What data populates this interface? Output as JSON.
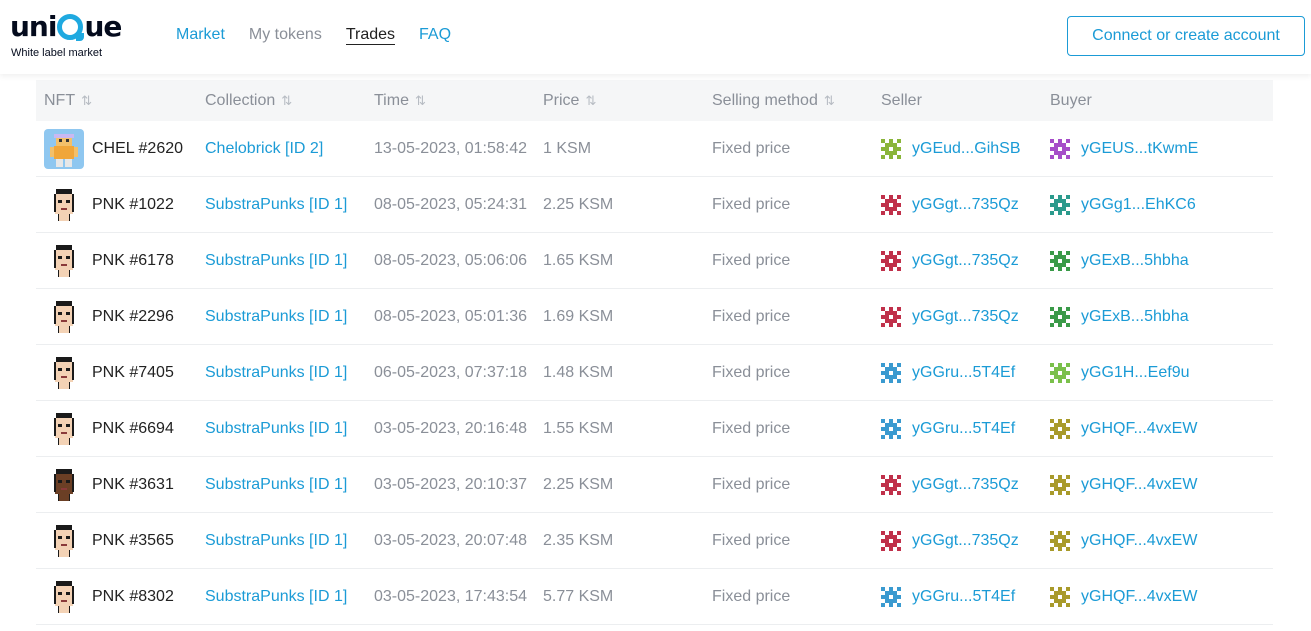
{
  "brand": {
    "logo_text_left": "uni",
    "logo_text_right": "ue",
    "tagline": "White label market"
  },
  "nav": {
    "market": "Market",
    "my_tokens": "My tokens",
    "trades": "Trades",
    "faq": "FAQ"
  },
  "connect_label": "Connect or create account",
  "columns": {
    "nft": "NFT",
    "collection": "Collection",
    "time": "Time",
    "price": "Price",
    "method": "Selling method",
    "seller": "Seller",
    "buyer": "Buyer"
  },
  "sort_icon": "⇅",
  "colors": {
    "accent": "#1b9bd6",
    "muted": "#8a8f98"
  },
  "rows": [
    {
      "nft": "CHEL #2620",
      "collection": "Chelobrick [ID 2]",
      "time": "13-05-2023, 01:58:42",
      "price": "1 KSM",
      "method": "Fixed price",
      "seller": "yGEud...GihSB",
      "buyer": "yGEUS...tKwmE",
      "seller_color": "#8ab53a",
      "buyer_color": "#a64dc9",
      "thumb": "chel"
    },
    {
      "nft": "PNK #1022",
      "collection": "SubstraPunks [ID 1]",
      "time": "08-05-2023, 05:24:31",
      "price": "2.25 KSM",
      "method": "Fixed price",
      "seller": "yGGgt...735Qz",
      "buyer": "yGGg1...EhKC6",
      "seller_color": "#c0304a",
      "buyer_color": "#2a9a8c",
      "thumb": "punk"
    },
    {
      "nft": "PNK #6178",
      "collection": "SubstraPunks [ID 1]",
      "time": "08-05-2023, 05:06:06",
      "price": "1.65 KSM",
      "method": "Fixed price",
      "seller": "yGGgt...735Qz",
      "buyer": "yGExB...5hbha",
      "seller_color": "#c0304a",
      "buyer_color": "#3a9a48",
      "thumb": "punk"
    },
    {
      "nft": "PNK #2296",
      "collection": "SubstraPunks [ID 1]",
      "time": "08-05-2023, 05:01:36",
      "price": "1.69 KSM",
      "method": "Fixed price",
      "seller": "yGGgt...735Qz",
      "buyer": "yGExB...5hbha",
      "seller_color": "#c0304a",
      "buyer_color": "#3a9a48",
      "thumb": "punk"
    },
    {
      "nft": "PNK #7405",
      "collection": "SubstraPunks [ID 1]",
      "time": "06-05-2023, 07:37:18",
      "price": "1.48 KSM",
      "method": "Fixed price",
      "seller": "yGGru...5T4Ef",
      "buyer": "yGG1H...Eef9u",
      "seller_color": "#3a9ad0",
      "buyer_color": "#7ac04a",
      "thumb": "punk"
    },
    {
      "nft": "PNK #6694",
      "collection": "SubstraPunks [ID 1]",
      "time": "03-05-2023, 20:16:48",
      "price": "1.55 KSM",
      "method": "Fixed price",
      "seller": "yGGru...5T4Ef",
      "buyer": "yGHQF...4vxEW",
      "seller_color": "#3a9ad0",
      "buyer_color": "#a89a2a",
      "thumb": "punk"
    },
    {
      "nft": "PNK #3631",
      "collection": "SubstraPunks [ID 1]",
      "time": "03-05-2023, 20:10:37",
      "price": "2.25 KSM",
      "method": "Fixed price",
      "seller": "yGGgt...735Qz",
      "buyer": "yGHQF...4vxEW",
      "seller_color": "#c0304a",
      "buyer_color": "#a89a2a",
      "thumb": "punk-dark"
    },
    {
      "nft": "PNK #3565",
      "collection": "SubstraPunks [ID 1]",
      "time": "03-05-2023, 20:07:48",
      "price": "2.35 KSM",
      "method": "Fixed price",
      "seller": "yGGgt...735Qz",
      "buyer": "yGHQF...4vxEW",
      "seller_color": "#c0304a",
      "buyer_color": "#a89a2a",
      "thumb": "punk"
    },
    {
      "nft": "PNK #8302",
      "collection": "SubstraPunks [ID 1]",
      "time": "03-05-2023, 17:43:54",
      "price": "5.77 KSM",
      "method": "Fixed price",
      "seller": "yGGru...5T4Ef",
      "buyer": "yGHQF...4vxEW",
      "seller_color": "#3a9ad0",
      "buyer_color": "#a89a2a",
      "thumb": "punk"
    }
  ]
}
